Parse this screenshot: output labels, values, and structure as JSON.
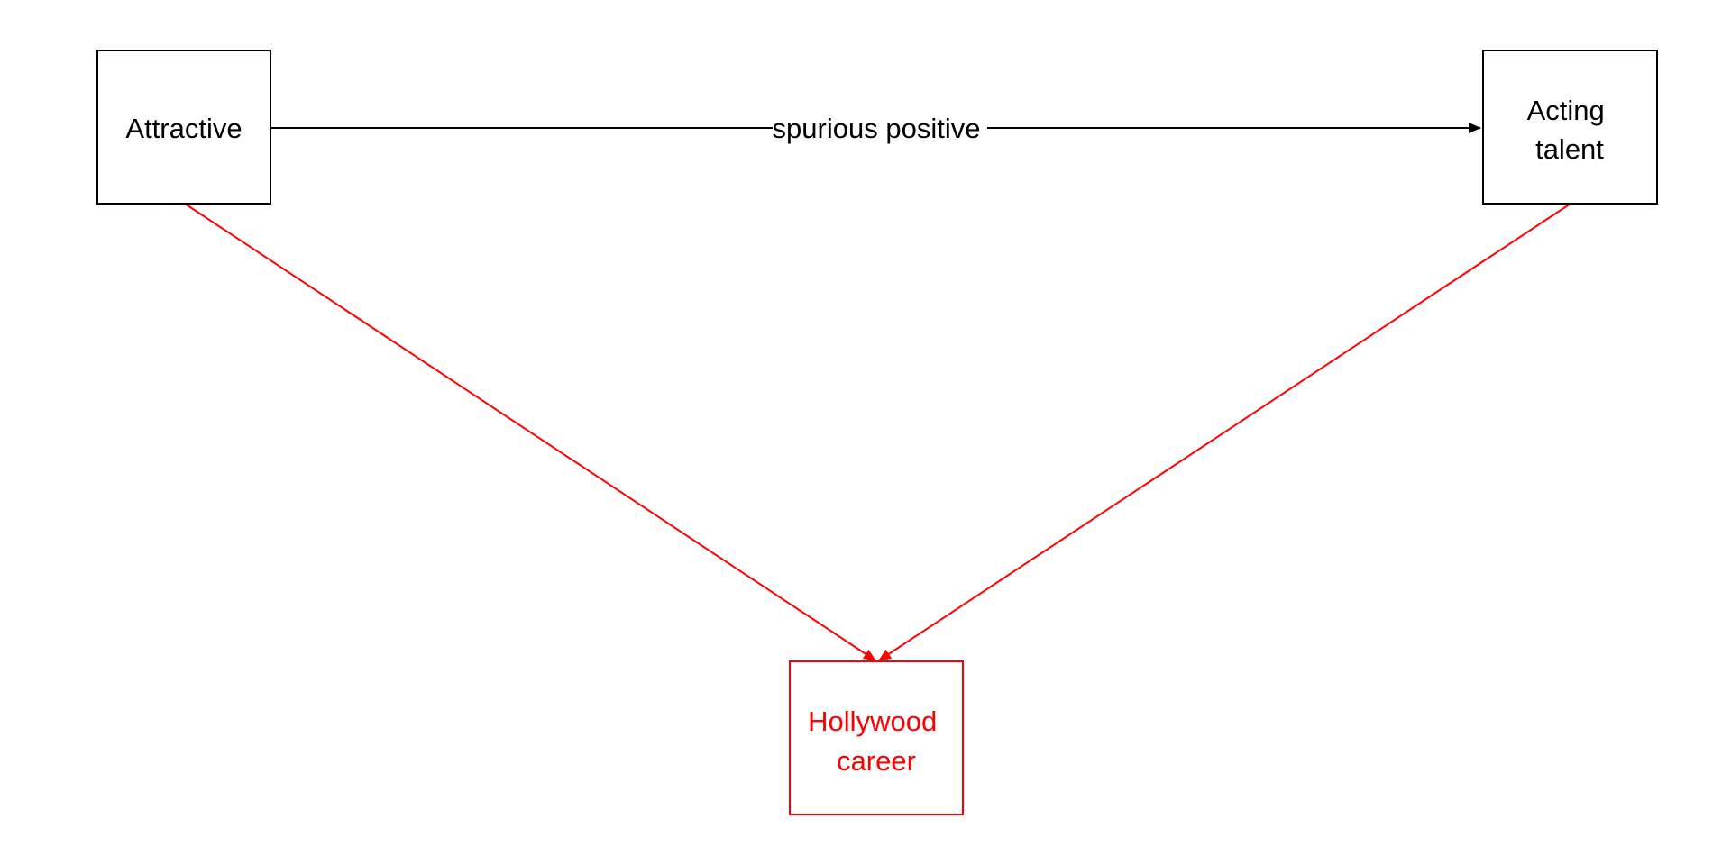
{
  "colors": {
    "default": "#000000",
    "highlight": "#ff0000",
    "background": "#ffffff"
  },
  "nodes": {
    "attractive": {
      "label_lines": [
        "Attractive"
      ],
      "color": "#000000"
    },
    "acting_talent": {
      "label_lines": [
        "Acting",
        "talent"
      ],
      "color": "#000000"
    },
    "hollywood_career": {
      "label_lines": [
        "Hollywood",
        "career"
      ],
      "color": "#ff0000"
    }
  },
  "edges": {
    "attractive_to_acting_talent": {
      "label": "spurious positive",
      "color": "#000000"
    },
    "attractive_to_hollywood_career": {
      "label": "",
      "color": "#ff0000"
    },
    "acting_talent_to_hollywood_career": {
      "label": "",
      "color": "#ff0000"
    }
  }
}
